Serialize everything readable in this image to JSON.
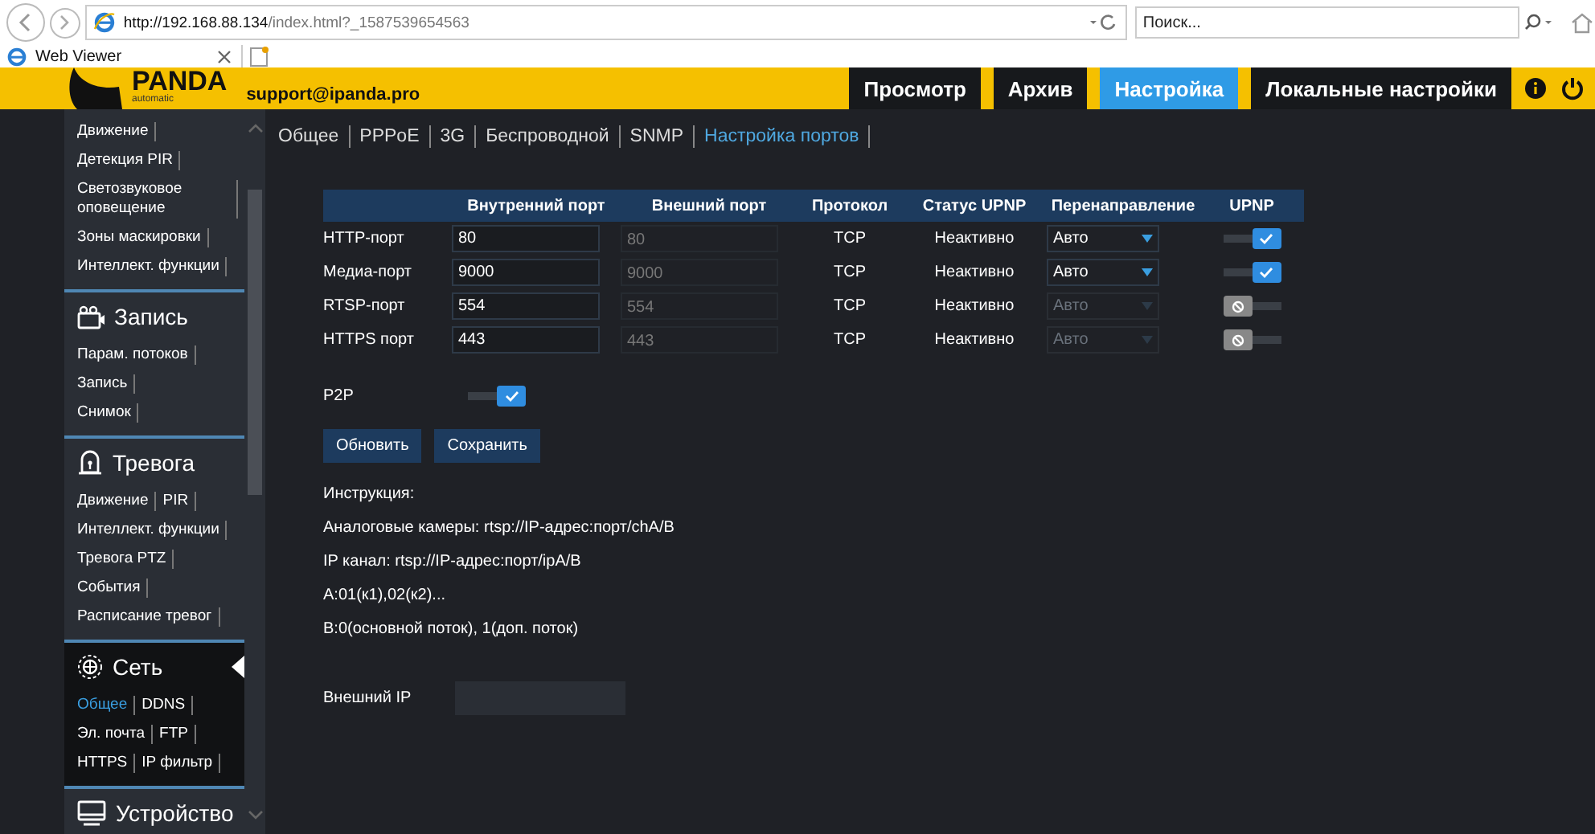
{
  "browser": {
    "url_host": "http://192.168.88.134",
    "url_path": "/index.html?_1587539654563",
    "search": {
      "placeholder": "Поиск..."
    },
    "tab": {
      "title": "Web Viewer"
    }
  },
  "header": {
    "logo": "PANDA",
    "logo_sub": "automatic",
    "email": "support@ipanda.pro",
    "nav": [
      {
        "label": "Просмотр",
        "selected": false
      },
      {
        "label": "Архив",
        "selected": false
      },
      {
        "label": "Настройка",
        "selected": true
      },
      {
        "label": "Локальные настройки",
        "selected": false
      }
    ]
  },
  "sidebar": {
    "sections": [
      {
        "rows": [
          [
            {
              "label": "Движение",
              "selected": false
            }
          ],
          [
            {
              "label": "Детекция PIR",
              "selected": false
            }
          ],
          [
            {
              "label": "Светозвуковое оповещение",
              "selected": false
            }
          ],
          [
            {
              "label": "Зоны маскировки",
              "selected": false
            }
          ],
          [
            {
              "label": "Интеллект. функции",
              "selected": false
            }
          ]
        ]
      },
      {
        "title": "Запись",
        "selected": false,
        "rows": [
          [
            {
              "label": "Парам. потоков",
              "selected": false
            }
          ],
          [
            {
              "label": "Запись",
              "selected": false
            }
          ],
          [
            {
              "label": "Снимок",
              "selected": false
            }
          ]
        ]
      },
      {
        "title": "Тревога",
        "selected": false,
        "rows": [
          [
            {
              "label": "Движение",
              "selected": false
            },
            {
              "label": "PIR",
              "selected": false
            }
          ],
          [
            {
              "label": "Интеллект. функции",
              "selected": false
            }
          ],
          [
            {
              "label": "Тревога PTZ",
              "selected": false
            }
          ],
          [
            {
              "label": "События",
              "selected": false
            }
          ],
          [
            {
              "label": "Расписание тревог",
              "selected": false
            }
          ]
        ]
      },
      {
        "title": "Сеть",
        "selected": true,
        "rows": [
          [
            {
              "label": "Общее",
              "selected": true
            },
            {
              "label": "DDNS",
              "selected": false
            }
          ],
          [
            {
              "label": "Эл. почта",
              "selected": false
            },
            {
              "label": "FTP",
              "selected": false
            }
          ],
          [
            {
              "label": "HTTPS",
              "selected": false
            },
            {
              "label": "IP фильтр",
              "selected": false
            }
          ]
        ]
      },
      {
        "title": "Устройство",
        "selected": false
      }
    ]
  },
  "subtabs": [
    {
      "label": "Общее",
      "selected": false
    },
    {
      "label": "PPPoE",
      "selected": false
    },
    {
      "label": "3G",
      "selected": false
    },
    {
      "label": "Беспроводной",
      "selected": false
    },
    {
      "label": "SNMP",
      "selected": false
    },
    {
      "label": "Настройка портов",
      "selected": true
    }
  ],
  "table": {
    "columns": [
      "Внутренний порт",
      "Внешний порт",
      "Протокол",
      "Статус UPNP",
      "Перенаправление",
      "UPNP"
    ],
    "rows": [
      {
        "name": "HTTP-порт",
        "internal": "80",
        "external": "80",
        "protocol": "TCP",
        "status": "Неактивно",
        "redirect": "Авто",
        "upnp": true
      },
      {
        "name": "Медиа-порт",
        "internal": "9000",
        "external": "9000",
        "protocol": "TCP",
        "status": "Неактивно",
        "redirect": "Авто",
        "upnp": true
      },
      {
        "name": "RTSP-порт",
        "internal": "554",
        "external": "554",
        "protocol": "TCP",
        "status": "Неактивно",
        "redirect": "Авто",
        "upnp": false
      },
      {
        "name": "HTTPS порт",
        "internal": "443",
        "external": "443",
        "protocol": "TCP",
        "status": "Неактивно",
        "redirect": "Авто",
        "upnp": false
      }
    ]
  },
  "p2p": {
    "label": "P2P",
    "on": true
  },
  "buttons": [
    "Обновить",
    "Сохранить"
  ],
  "instructions": [
    "Инструкция:",
    "Аналоговые камеры: rtsp://IP-адрес:порт/chA/B",
    "IP канал: rtsp://IP-адрес:порт/ipA/B",
    "A:01(к1),02(к2)...",
    "B:0(основной поток), 1(доп. поток)"
  ],
  "external_ip": {
    "label": "Внешний IP"
  }
}
